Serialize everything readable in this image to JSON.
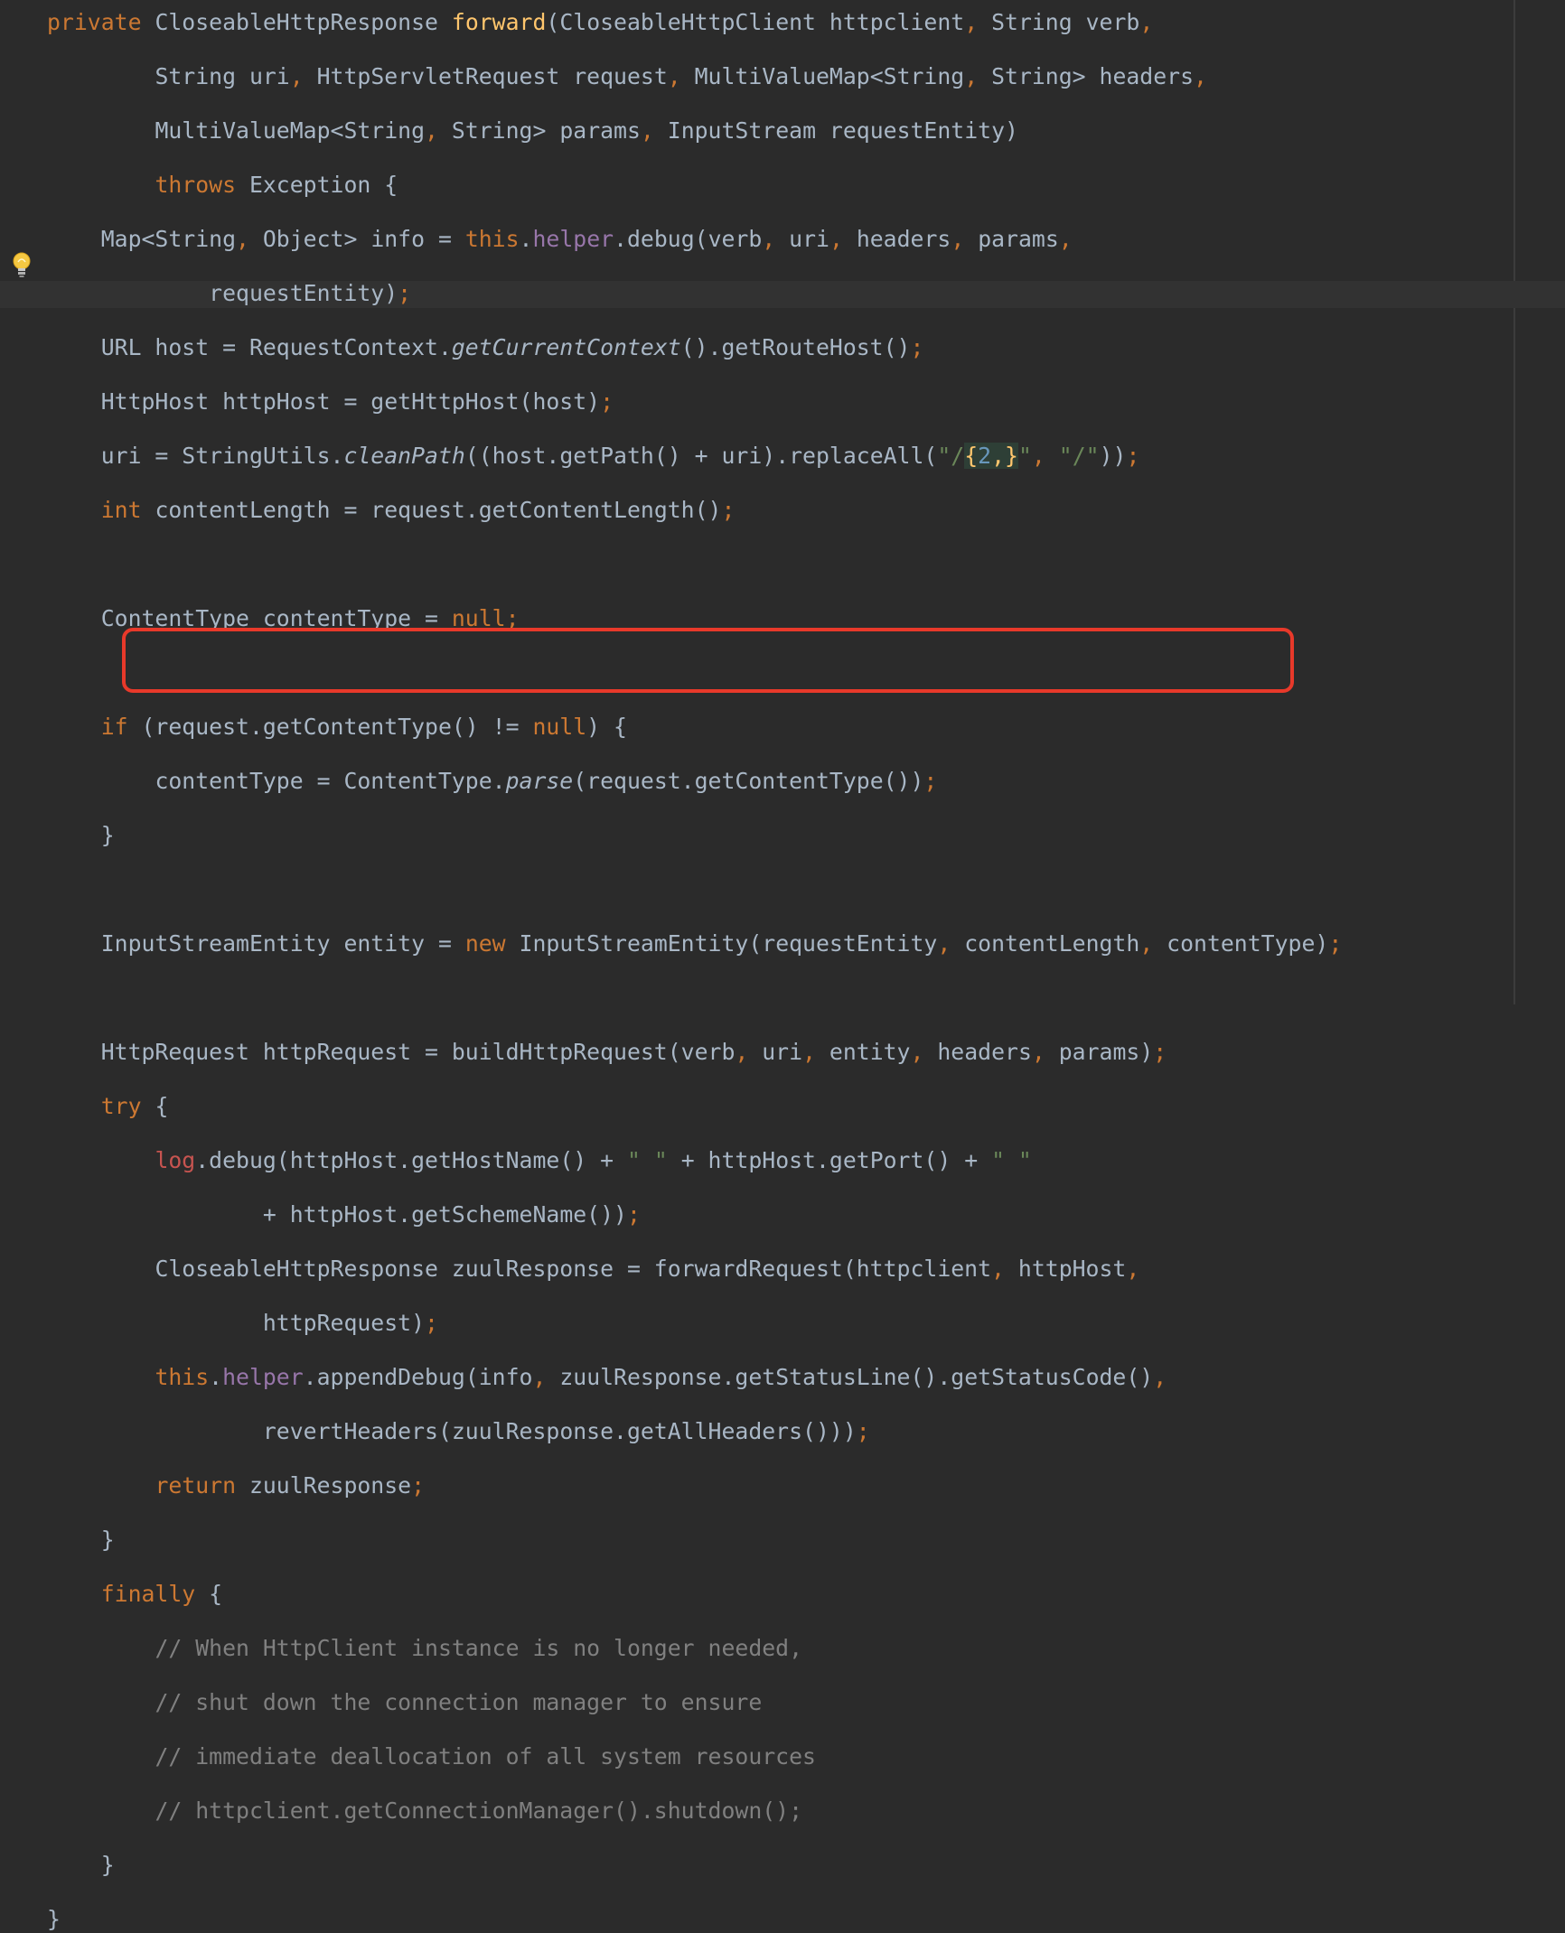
{
  "colors": {
    "background": "#2b2b2b",
    "keyword": "#cc7832",
    "method_declaration": "#ffc66d",
    "string": "#6a8759",
    "number": "#6897bb",
    "field": "#9876aa",
    "comment": "#808080",
    "highlight_box": "#e8392a"
  },
  "icons": {
    "gutter": "lightbulb-icon"
  },
  "code": {
    "l1_kw": "private",
    "l1_a": " CloseableHttpResponse ",
    "l1_fn": "forward",
    "l1_b": "(CloseableHttpClient httpclient",
    "l1_c": " String verb",
    "l2_a": "String uri",
    "l2_b": " HttpServletRequest request",
    "l2_c": " MultiValueMap<String",
    "l2_d": " String> headers",
    "l3_a": "MultiValueMap<String",
    "l3_b": " String> params",
    "l3_c": " InputStream requestEntity)",
    "l4_kw": "throws",
    "l4_a": " Exception {",
    "l5_a": "Map<String",
    "l5_b": " Object> info = ",
    "l5_this": "this",
    "l5_dot": ".",
    "l5_helper": "helper",
    "l5_c": ".debug(verb",
    "l5_d": " uri",
    "l5_e": " headers",
    "l5_f": " params",
    "l6_a": "requestEntity)",
    "l7_a": "URL host = RequestContext.",
    "l7_it": "getCurrentContext",
    "l7_b": "().getRouteHost()",
    "l8_a": "HttpHost httpHost = getHttpHost(host)",
    "l9_a": "uri = StringUtils.",
    "l9_it": "cleanPath",
    "l9_b": "((host.getPath() + uri).replaceAll(",
    "l9_q1": "\"",
    "l9_slash": "/",
    "l9_br1": "{",
    "l9_two": "2",
    "l9_comma": ",",
    "l9_br2": "}",
    "l9_q2": "\"",
    "l9_s2": "\"/\"",
    "l9_c": "))",
    "l10_kw": "int",
    "l10_a": " contentLength = request.getContentLength()",
    "l12_a": "ContentType contentType = ",
    "l12_null": "null",
    "l14_if": "if",
    "l14_a": " (request.getContentType() != ",
    "l14_null": "null",
    "l14_b": ") {",
    "l15_a": "contentType = ContentType.",
    "l15_it": "parse",
    "l15_b": "(request.getContentType())",
    "l16_a": "}",
    "l18_a": "InputStreamEntity entity = ",
    "l18_new": "new",
    "l18_b": " InputStreamEntity(requestEntity",
    "l18_c": " contentLength",
    "l18_d": " contentType)",
    "l20_a": "HttpRequest httpRequest = buildHttpRequest(verb",
    "l20_b": " uri",
    "l20_c": " entity",
    "l20_d": " headers",
    "l20_e": " params)",
    "l21_try": "try",
    "l21_a": " {",
    "l22_log": "log",
    "l22_a": ".debug(httpHost.getHostName() + ",
    "l22_s1": "\" \"",
    "l22_b": " + httpHost.getPort() + ",
    "l22_s2": "\" \"",
    "l23_a": "+ httpHost.getSchemeName())",
    "l24_a": "CloseableHttpResponse zuulResponse = forwardRequest(httpclient",
    "l24_b": " httpHost",
    "l25_a": "httpRequest)",
    "l26_this": "this",
    "l26_dot": ".",
    "l26_helper": "helper",
    "l26_a": ".appendDebug(info",
    "l26_b": " zuulResponse.getStatusLine().getStatusCode()",
    "l27_a": "revertHeaders(zuulResponse.getAllHeaders()))",
    "l28_return": "return",
    "l28_a": " zuulResponse",
    "l29_a": "}",
    "l30_finally": "finally",
    "l30_a": " {",
    "l31_c": "// When HttpClient instance is no longer needed,",
    "l32_c": "// shut down the connection manager to ensure",
    "l33_c": "// immediate deallocation of all system resources",
    "l34_c": "// httpclient.getConnectionManager().shutdown();",
    "l35_a": "}",
    "l36_a": "}",
    "comma": ",",
    "semi": ";"
  }
}
